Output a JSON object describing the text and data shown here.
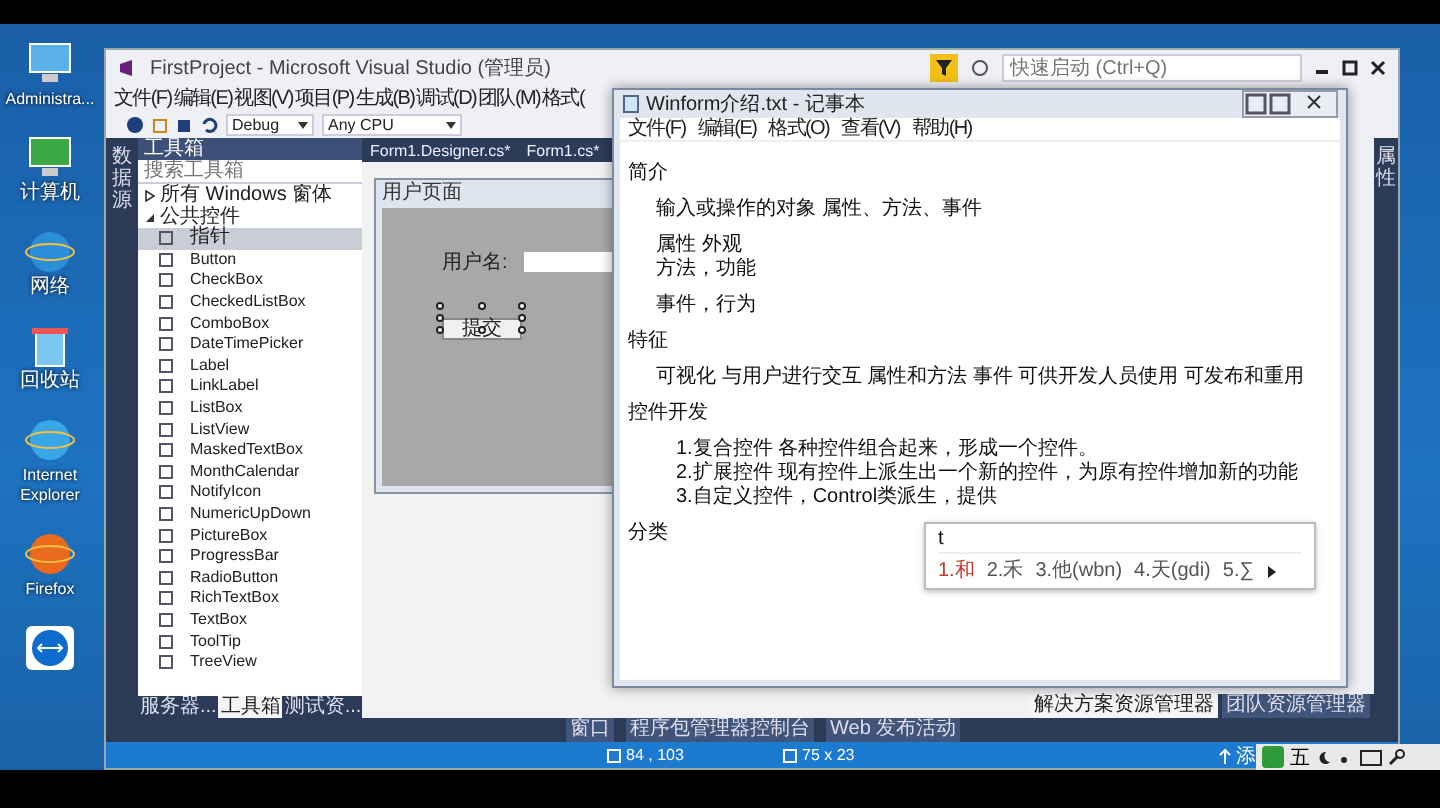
{
  "desktop_icons": [
    {
      "label": "Administra...",
      "kind": "monitor"
    },
    {
      "label": "计算机",
      "kind": "computer"
    },
    {
      "label": "网络",
      "kind": "globe"
    },
    {
      "label": "回收站",
      "kind": "bin"
    },
    {
      "label": "Internet Explorer",
      "kind": "ie"
    },
    {
      "label": "Firefox",
      "kind": "firefox"
    },
    {
      "kind": "remote"
    }
  ],
  "vs": {
    "title": "FirstProject - Microsoft Visual Studio (管理员)",
    "quick_launch": {
      "placeholder": "快速启动 (Ctrl+Q)"
    },
    "menu": [
      "文件(F)",
      "编辑(E)",
      "视图(V)",
      "项目(P)",
      "生成(B)",
      "调试(D)",
      "团队(M)",
      "格式("
    ],
    "toolbar": {
      "configuration": "Debug",
      "platform": "Any CPU"
    },
    "left_strip": "数据源",
    "toolbox": {
      "title": "工具箱",
      "search": {
        "placeholder": "搜索工具箱"
      },
      "groups": [
        {
          "label": "所有 Windows 窗体",
          "expanded": false
        },
        {
          "label": "公共控件",
          "expanded": true,
          "children": [
            {
              "label": "指针",
              "selected": true
            },
            {
              "label": "Button",
              "selected": false
            },
            {
              "label": "CheckBox",
              "selected": false
            },
            {
              "label": "CheckedListBox",
              "selected": false
            },
            {
              "label": "ComboBox",
              "selected": false
            },
            {
              "label": "DateTimePicker",
              "selected": false
            },
            {
              "label": "Label",
              "selected": false
            },
            {
              "label": "LinkLabel",
              "selected": false
            },
            {
              "label": "ListBox",
              "selected": false
            },
            {
              "label": "ListView",
              "selected": false
            },
            {
              "label": "MaskedTextBox",
              "selected": false
            },
            {
              "label": "MonthCalendar",
              "selected": false
            },
            {
              "label": "NotifyIcon",
              "selected": false
            },
            {
              "label": "NumericUpDown",
              "selected": false
            },
            {
              "label": "PictureBox",
              "selected": false
            },
            {
              "label": "ProgressBar",
              "selected": false
            },
            {
              "label": "RadioButton",
              "selected": false
            },
            {
              "label": "RichTextBox",
              "selected": false
            },
            {
              "label": "TextBox",
              "selected": false
            },
            {
              "label": "ToolTip",
              "selected": false
            },
            {
              "label": "TreeView",
              "selected": false
            }
          ]
        }
      ],
      "tabs": [
        {
          "label": "服务器...",
          "selected": false
        },
        {
          "label": "工具箱",
          "selected": true
        },
        {
          "label": "测试资...",
          "selected": false
        }
      ]
    },
    "document_tabs": [
      "Form1.Designer.cs*",
      "Form1.cs*"
    ],
    "form": {
      "title": "用户页面",
      "label": "用户名:",
      "button": "提交"
    },
    "explorer_tabs": [
      {
        "label": "解决方案资源管理器",
        "selected": true
      },
      {
        "label": "团队资源管理器",
        "selected": false
      }
    ],
    "right_strip": "属性",
    "bottom_tabs": [
      "窗口",
      "程序包管理器控制台",
      "Web 发布活动"
    ],
    "status": {
      "position": "84 , 103",
      "size": "75 x 23",
      "right": "添"
    }
  },
  "notepad": {
    "title": "Winform介绍.txt - 记事本",
    "menu": [
      "文件(F)",
      "编辑(E)",
      "格式(O)",
      "查看(V)",
      "帮助(H)"
    ],
    "lines": [
      {
        "kind": "heading",
        "text": "简介"
      },
      {
        "kind": "item",
        "text": "输入或操作的对象 属性、方法、事件"
      },
      {
        "kind": "item",
        "text": "属性 外观"
      },
      {
        "kind": "continuation",
        "text": "方法，功能"
      },
      {
        "kind": "item",
        "text": "事件，行为"
      },
      {
        "kind": "heading",
        "text": "特征"
      },
      {
        "kind": "item",
        "text": "可视化 与用户进行交互 属性和方法 事件 可供开发人员使用 可发布和重用"
      },
      {
        "kind": "heading",
        "text": "控件开发"
      },
      {
        "kind": "list",
        "text": "1.复合控件 各种控件组合起来，形成一个控件。"
      },
      {
        "kind": "list_continuation",
        "text": "2.扩展控件 现有控件上派生出一个新的控件，为原有控件增加新的功能"
      },
      {
        "kind": "list_continuation",
        "text": "3.自定义控件，Control类派生，提供"
      },
      {
        "kind": "heading",
        "text": "分类"
      }
    ],
    "ime": {
      "input": "t",
      "candidates": [
        {
          "text": "1.和",
          "selected": true
        },
        {
          "text": "2.禾",
          "selected": false
        },
        {
          "text": "3.他(wbn)",
          "selected": false
        },
        {
          "text": "4.天(gdi)",
          "selected": false
        },
        {
          "text": "5.∑",
          "selected": false
        }
      ]
    }
  },
  "tray": {
    "mode": "五"
  }
}
